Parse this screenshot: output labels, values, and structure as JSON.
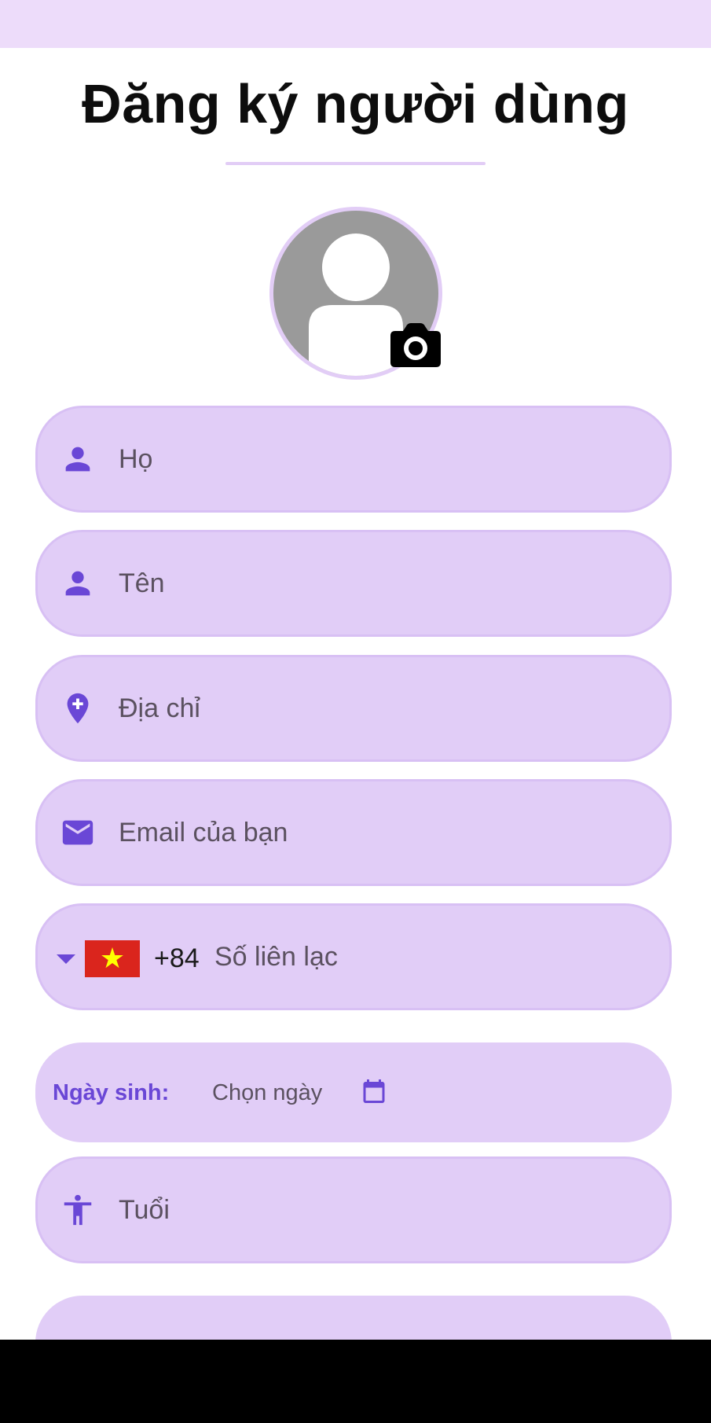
{
  "header": {
    "title": "Đăng ký người dùng"
  },
  "avatar": {
    "icon": "default-person-avatar",
    "badge_icon": "camera-icon"
  },
  "form": {
    "last_name": {
      "placeholder": "Họ",
      "value": "",
      "icon": "person-icon"
    },
    "first_name": {
      "placeholder": "Tên",
      "value": "",
      "icon": "person-icon"
    },
    "address": {
      "placeholder": "Địa chỉ",
      "value": "",
      "icon": "add-location-icon"
    },
    "email": {
      "placeholder": "Email của bạn",
      "value": "",
      "icon": "mail-icon"
    },
    "phone": {
      "country_flag": "vietnam-flag",
      "flag_star": "★",
      "dial_code": "+84",
      "placeholder": "Số liên lạc",
      "value": ""
    },
    "dob": {
      "label": "Ngày sinh:",
      "value": "Chọn ngày",
      "icon": "calendar-icon"
    },
    "age": {
      "placeholder": "Tuổi",
      "value": "",
      "icon": "accessibility-icon"
    }
  },
  "colors": {
    "accent": "#6a47d6",
    "field_background": "#e1cdf7",
    "status_bar": "#eddcfa",
    "flag_red": "#da251d",
    "flag_star": "#ffff00"
  }
}
